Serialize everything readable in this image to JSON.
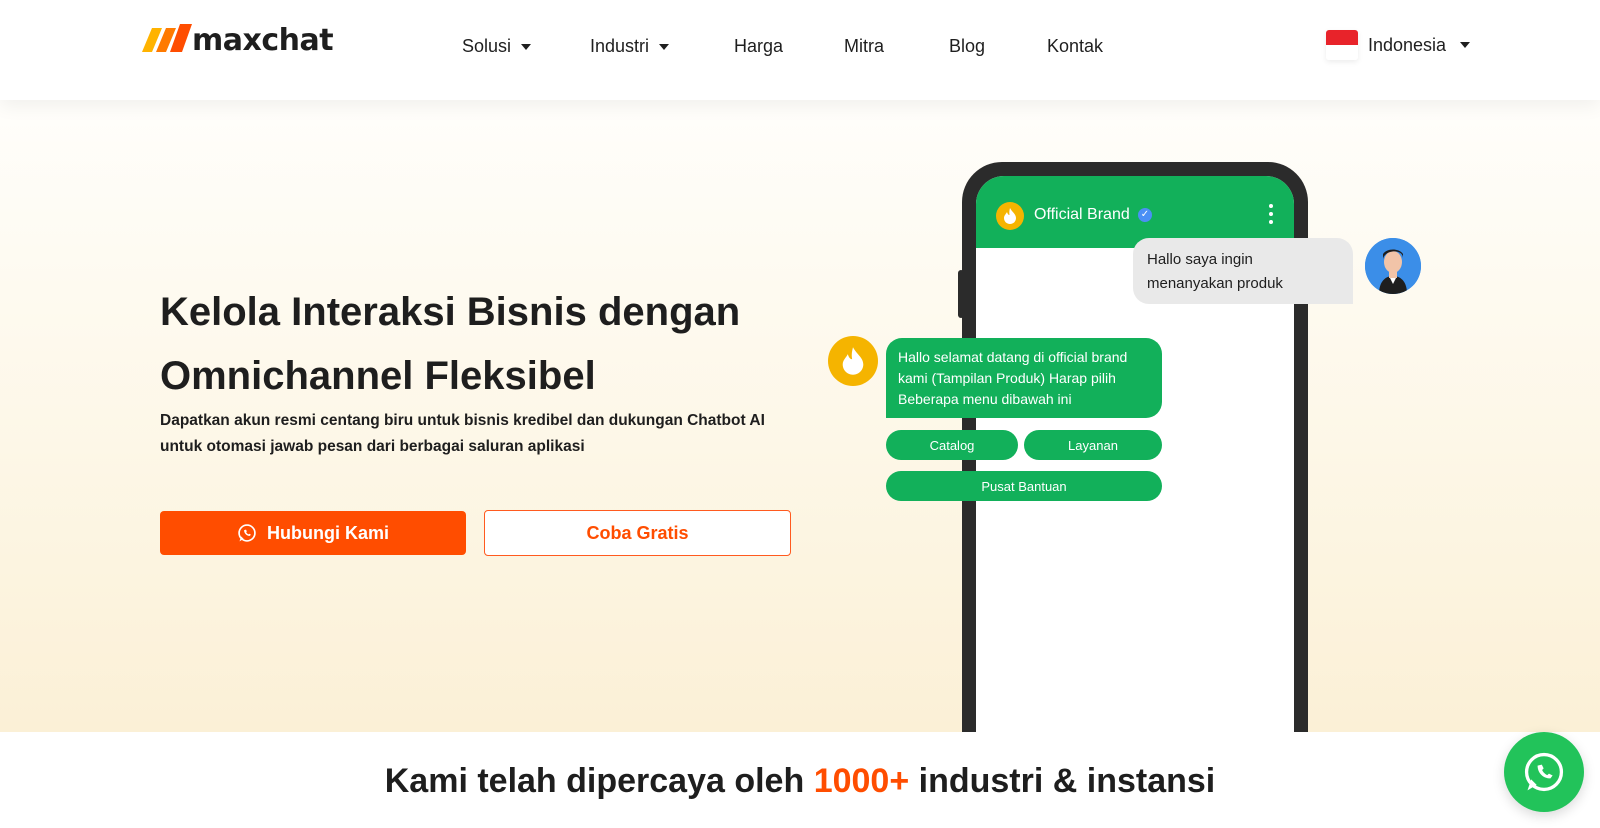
{
  "brand": {
    "logo_text": "maxchat",
    "accent": "#ff4d00"
  },
  "nav": {
    "items": [
      {
        "label": "Solusi",
        "dropdown": true
      },
      {
        "label": "Industri",
        "dropdown": true
      },
      {
        "label": "Harga",
        "dropdown": false
      },
      {
        "label": "Mitra",
        "dropdown": false
      },
      {
        "label": "Blog",
        "dropdown": false
      },
      {
        "label": "Kontak",
        "dropdown": false
      }
    ],
    "language": "Indonesia"
  },
  "hero": {
    "title_line1": "Kelola Interaksi Bisnis dengan",
    "title_line2": "Omnichannel Fleksibel",
    "subtitle": "Dapatkan akun resmi centang biru untuk bisnis kredibel dan dukungan Chatbot AI untuk otomasi jawab pesan dari berbagai saluran aplikasi",
    "primary_button": "Hubungi Kami",
    "secondary_button": "Coba Gratis"
  },
  "phone": {
    "brand_name": "Official Brand",
    "user_message": "Hallo saya ingin menanyakan produk",
    "bot_message": "Hallo selamat datang di official brand kami (Tampilan Produk) Harap pilih Beberapa menu dibawah ini",
    "options": [
      "Catalog",
      "Layanan",
      "Pusat Bantuan"
    ]
  },
  "trust": {
    "prefix": "Kami telah dipercaya oleh ",
    "highlight": "1000+",
    "suffix": " industri & instansi"
  },
  "colors": {
    "green": "#12b05a",
    "orange": "#ff4d00",
    "yellow": "#f5b400",
    "whatsapp": "#22c35a"
  },
  "icons": {
    "primary_button": "whatsapp-icon",
    "floating": "whatsapp-icon",
    "caret": "chevron-down-icon"
  }
}
